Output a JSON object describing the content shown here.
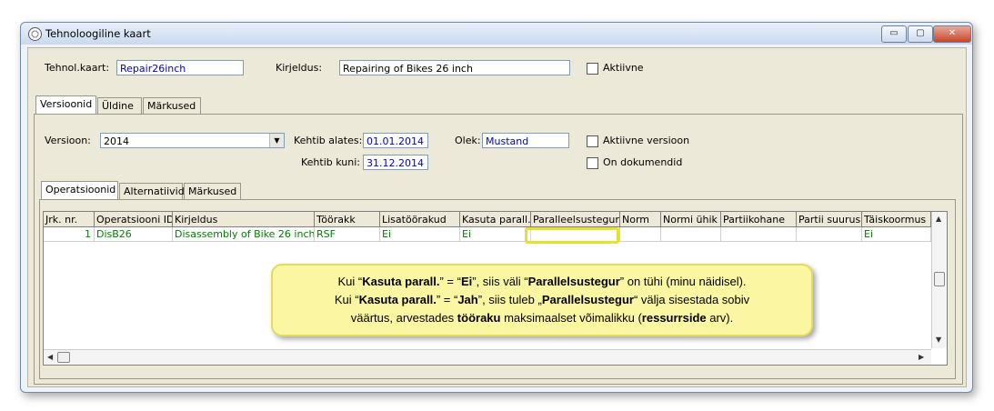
{
  "window": {
    "title": "Tehnoloogiline kaart",
    "minimize": "▭",
    "maximize": "▢",
    "close": "✕"
  },
  "header": {
    "tehnol_label": "Tehnol.kaart:",
    "tehnol_value": "Repair26inch",
    "kirjeldus_label": "Kirjeldus:",
    "kirjeldus_value": "Repairing of Bikes 26 inch",
    "aktiivne_label": "Aktiivne"
  },
  "tabs_top": [
    "Versioonid",
    "Üldine",
    "Märkused"
  ],
  "version": {
    "versioon_label": "Versioon:",
    "versioon_value": "2014",
    "kehtib_alates_label": "Kehtib alates:",
    "kehtib_alates_value": "01.01.2014",
    "kehtib_kuni_label": "Kehtib kuni:",
    "kehtib_kuni_value": "31.12.2014",
    "olek_label": "Olek:",
    "olek_value": "Mustand",
    "aktiivne_versioon_label": "Aktiivne versioon",
    "on_dokumendid_label": "On dokumendid"
  },
  "tabs_inner": [
    "Operatsioonid",
    "Alternatiivid",
    "Märkused"
  ],
  "grid": {
    "columns": [
      "Jrk. nr.",
      "Operatsiooni ID",
      "Kirjeldus",
      "Töörakk",
      "Lisatöörakud",
      "Kasuta parall.",
      "Paralleelsustegur",
      "Norm",
      "Normi ühik",
      "Partiikohane",
      "Partii suurus",
      "Täiskoormus"
    ],
    "rows": [
      [
        "1",
        "DisB26",
        "Disassembly of Bike 26 inch",
        "RSF",
        "Ei",
        "Ei",
        "",
        "",
        "",
        "",
        "",
        "Ei"
      ]
    ]
  },
  "callout": {
    "line1_a": "Kui “",
    "line1_b": "Kasuta parall.",
    "line1_c": "” = “",
    "line1_d": "Ei",
    "line1_e": "”, siis väli “",
    "line1_f": "Parallelsustegur",
    "line1_g": "” on tühi (minu näidisel).",
    "line2_a": "Kui “",
    "line2_b": "Kasuta parall.",
    "line2_c": "” = “",
    "line2_d": "Jah",
    "line2_e": "”, siis tuleb „",
    "line2_f": "Parallelsustegur",
    "line2_g": "“ välja sisestada sobiv",
    "line3_a": "väärtus, arvestades ",
    "line3_b": "tööraku",
    "line3_c": " maksimaalset võimalikku (",
    "line3_d": "ressurrside",
    "line3_e": " arv)."
  },
  "colors": {
    "accent_text": "#0000cc",
    "grid_text": "#008000",
    "callout_bg": "#fbf6a2",
    "highlight": "#e6e030"
  }
}
